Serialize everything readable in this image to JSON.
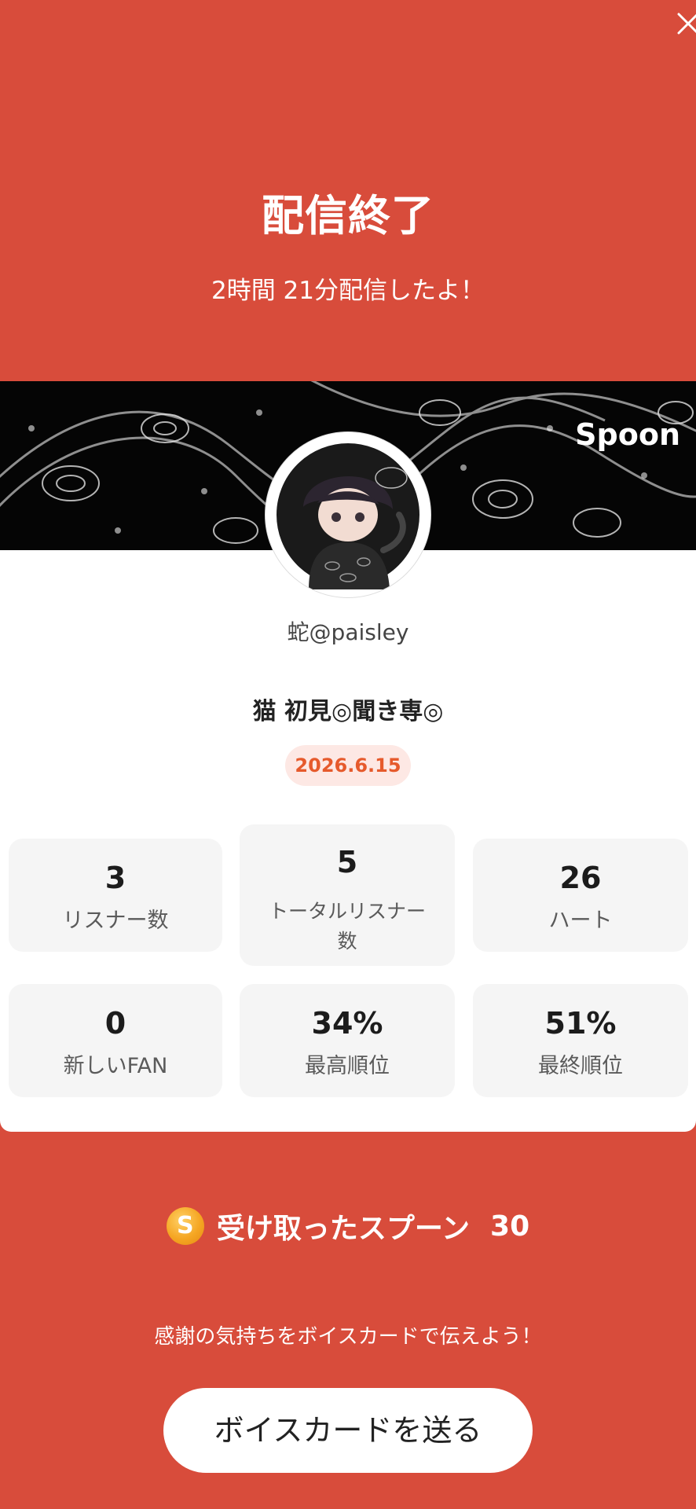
{
  "header": {
    "title": "配信終了",
    "subtitle": "2時間 21分配信したよ！"
  },
  "profile": {
    "banner_logo": "Spoon",
    "username": "蛇@paisley",
    "stream_title": "猫  初見◎聞き専◎",
    "date": "2026.6.15"
  },
  "stats": [
    {
      "value": "3",
      "label": "リスナー数"
    },
    {
      "value": "5",
      "label": "トータルリスナー数"
    },
    {
      "value": "26",
      "label": "ハート"
    },
    {
      "value": "0",
      "label": "新しいFAN"
    },
    {
      "value": "34%",
      "label": "最高順位"
    },
    {
      "value": "51%",
      "label": "最終順位"
    }
  ],
  "spoons": {
    "coin_letter": "S",
    "label": "受け取ったスプーン",
    "count": "30"
  },
  "thanks_text": "感謝の気持ちをボイスカードで伝えよう！",
  "send_button": "ボイスカードを送る",
  "icons": {
    "close": "close-icon",
    "coin": "spoon-coin-icon"
  },
  "colors": {
    "background": "#d84c3b",
    "date_badge_text": "#e65a2c",
    "date_badge_bg": "#fde8e4"
  }
}
